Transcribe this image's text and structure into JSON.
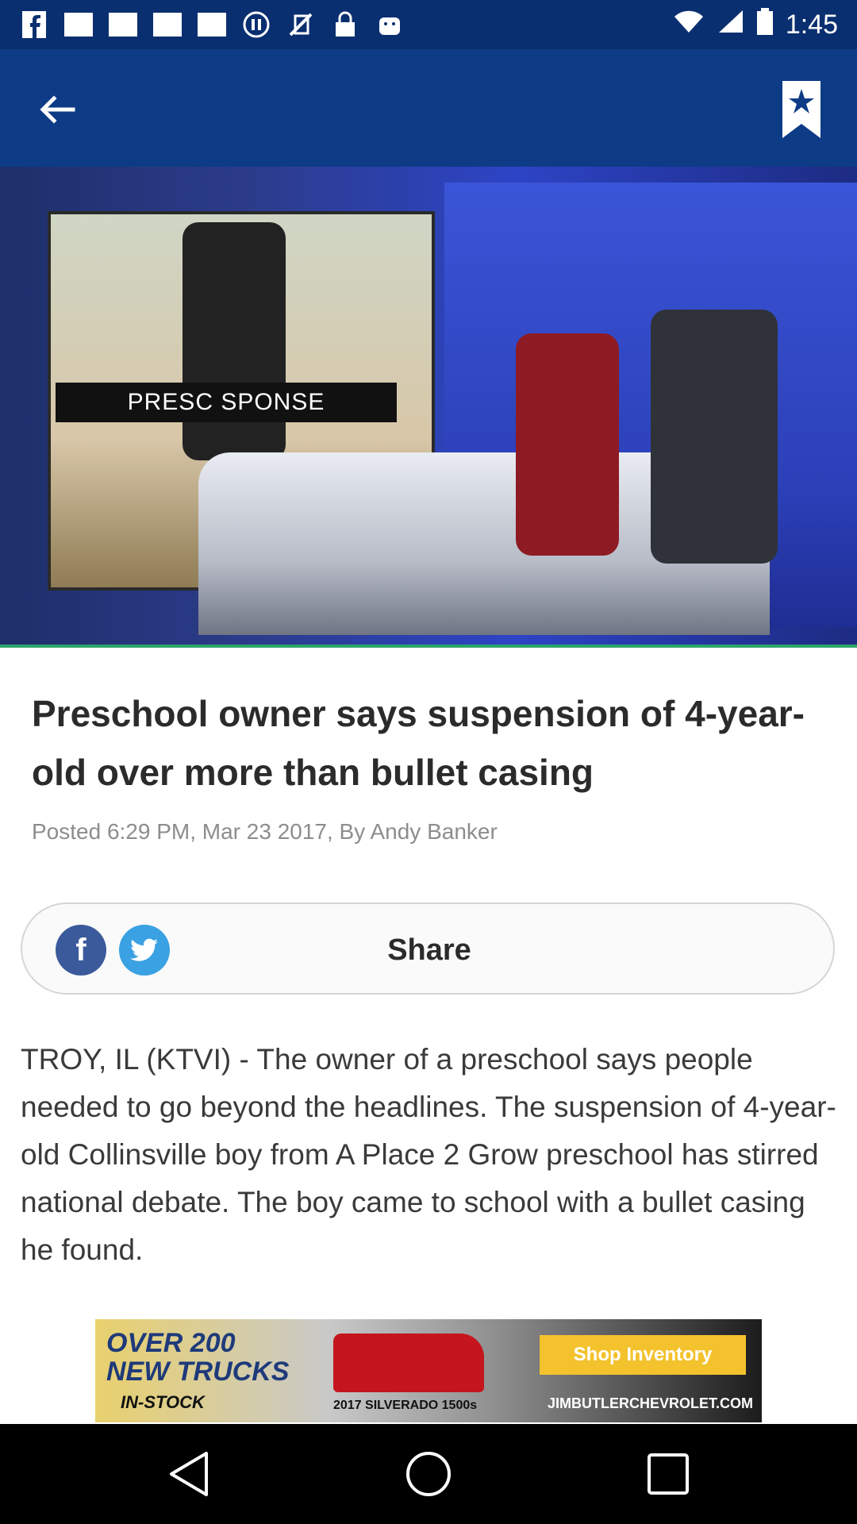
{
  "status_bar": {
    "time": "1:45",
    "icons": [
      "facebook-icon",
      "image-icon",
      "image-icon",
      "image-icon",
      "image-icon",
      "pause-icon",
      "no-sim-icon",
      "lock-icon",
      "android-icon",
      "wifi-icon",
      "signal-icon",
      "battery-icon"
    ]
  },
  "app_bar": {
    "back_icon": "arrow-left-icon",
    "bookmark_icon": "bookmark-star-icon"
  },
  "hero": {
    "lower_third_text": "PRESC         SPONSE"
  },
  "article": {
    "headline": "Preschool owner says suspension of 4-year-old over more than bullet casing",
    "byline": "Posted 6:29 PM, Mar 23 2017, By Andy Banker",
    "share": {
      "label": "Share",
      "facebook_glyph": "f"
    },
    "body": "TROY, IL (KTVI) - The owner of a preschool says people needed to go beyond the headlines. The suspension of 4-year-old Collinsville boy from A Place 2 Grow preschool has stirred national debate. The boy came to school with a bullet casing he found."
  },
  "ad": {
    "headline": "OVER 200 NEW TRUCKS",
    "subline": "IN-STOCK",
    "model": "2017 SILVERADO 1500s",
    "button": "Shop Inventory",
    "url": "JIMBUTLERCHEVROLET.COM"
  },
  "colors": {
    "status_bar": "#0a2f70",
    "app_bar": "#0d3b86",
    "facebook": "#3b5a9b",
    "twitter": "#3aa1e3"
  }
}
